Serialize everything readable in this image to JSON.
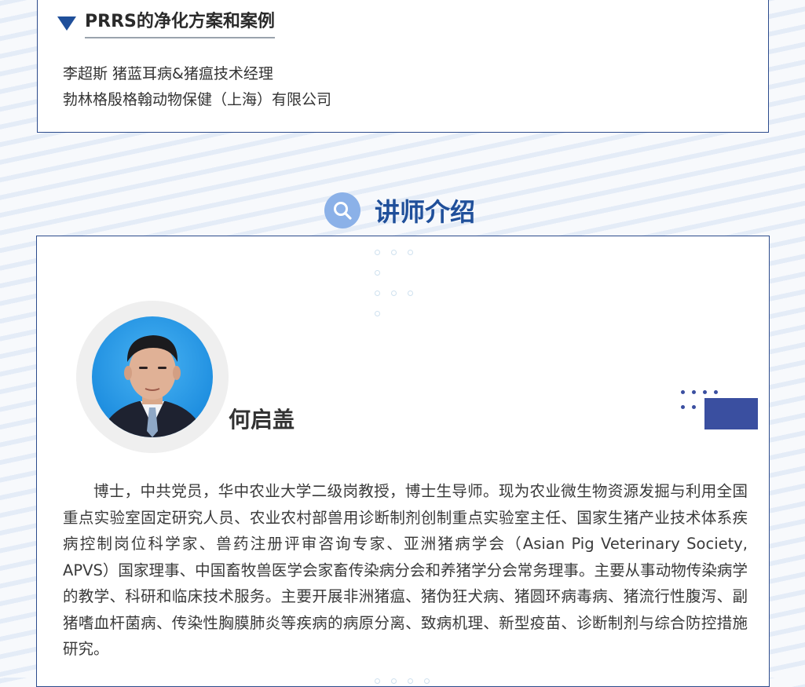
{
  "topic": {
    "title": "PRRS的净化方案和案例",
    "speaker_line": "李超斯 猪蓝耳病&猪瘟技术经理",
    "company_line": "勃林格殷格翰动物保健（上海）有限公司"
  },
  "section": {
    "title": "讲师介绍",
    "icon": "search-icon"
  },
  "lecturer": {
    "name": "何启盖",
    "bio": "博士，中共党员，华中农业大学二级岗教授，博士生导师。现为农业微生物资源发掘与利用全国重点实验室固定研究人员、农业农村部兽用诊断制剂创制重点实验室主任、国家生猪产业技术体系疾病控制岗位科学家、兽药注册评审咨询专家、亚洲猪病学会（Asian Pig Veterinary Society, APVS）国家理事、中国畜牧兽医学会家畜传染病分会和养猪学分会常务理事。主要从事动物传染病学的教学、科研和临床技术服务。主要开展非洲猪瘟、猪伪狂犬病、猪圆环病毒病、猪流行性腹泻、副猪嗜血杆菌病、传染性胸膜肺炎等疾病的病原分离、致病机理、新型疫苗、诊断制剂与综合防控措施研究。"
  },
  "colors": {
    "accent": "#1f4f9a",
    "icon_circle": "#8bb1e8",
    "deco_block": "#3a4fa0",
    "border": "#2c4b8c"
  }
}
